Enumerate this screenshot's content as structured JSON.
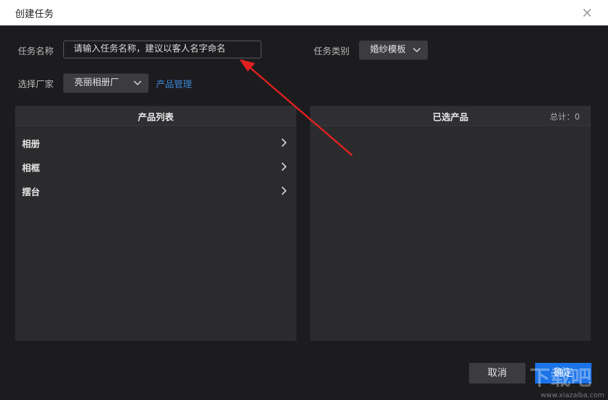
{
  "dialog": {
    "title": "创建任务"
  },
  "form": {
    "task_name_label": "任务名称",
    "task_name_placeholder": "请输入任务名称，建议以客人名字命名",
    "task_type_label": "任务类别",
    "task_type_value": "婚纱模板",
    "vendor_label": "选择厂家",
    "vendor_value": "亮丽相册厂",
    "product_manage_link": "产品管理"
  },
  "product_list": {
    "title": "产品列表",
    "items": [
      {
        "label": "相册"
      },
      {
        "label": "相框"
      },
      {
        "label": "摆台"
      }
    ]
  },
  "selected_products": {
    "title": "已选产品",
    "total_label": "总计：0"
  },
  "buttons": {
    "cancel": "取消",
    "ok": "确定"
  },
  "colors": {
    "accent": "#1a73e8",
    "link": "#3d87d8",
    "annotation_arrow": "#e02020"
  },
  "icons": {
    "close": "close-icon",
    "dropdown": "chevron-down-icon",
    "item": "chevron-right-icon"
  }
}
